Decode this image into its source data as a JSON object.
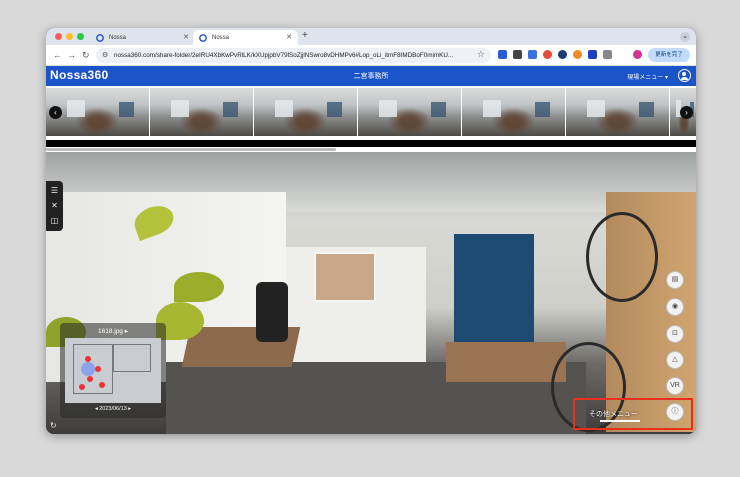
{
  "browser": {
    "tabs": [
      {
        "title": "Nossa",
        "active": false
      },
      {
        "title": "Nossa",
        "active": true
      }
    ],
    "new_tab_symbol": "+",
    "url": "nossa360.com/share-folder/2eIRU4XbKwPvRlLK/kXUpjpbV79lSoZjjlNSwro8vDHMPv6#Lop_oLi_itmF8IMDBoF0mimKU...",
    "update_button": "更新を完了"
  },
  "app": {
    "logo": "Nossa360",
    "title": "二宮事務所",
    "site_menu": "現場メニュー",
    "brand_color": "#1b53c8"
  },
  "thumbnails": {
    "count": 7
  },
  "minimap": {
    "image_name": "1618.jpg",
    "date": "2023/06/13"
  },
  "right_toolbar": {
    "vr_label": "VR",
    "more_menu_label": "その他メニュー"
  },
  "icons": {
    "left_tools": [
      "list-icon",
      "close-icon",
      "compare-icon"
    ],
    "right_tools": [
      "comment-icon",
      "eye-icon",
      "capture-icon",
      "measure-icon",
      "vr-icon",
      "info-icon"
    ]
  },
  "highlight_color": "#e8301d"
}
